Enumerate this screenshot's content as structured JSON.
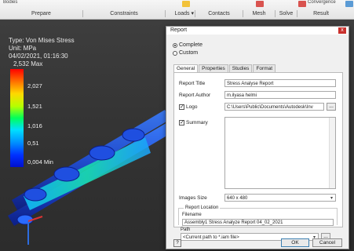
{
  "ribbon": {
    "top_left": "Bodies",
    "top_right": "Convergence",
    "groups": [
      "Prepare",
      "Constraints",
      "Loads",
      "Contacts",
      "Mesh",
      "Solve",
      "Result"
    ],
    "loads_arrow": "▾"
  },
  "legend": {
    "type_label": "Type: Von Mises Stress",
    "unit_label": "Unit: MPa",
    "timestamp": "04/02/2021, 01:16:30",
    "max_label": "2,532 Max",
    "ticks": [
      "2,027",
      "1,521",
      "1,016",
      "0,51",
      "0,004 Min"
    ]
  },
  "dialog": {
    "title": "Report",
    "close": "x",
    "radio_complete": "Complete",
    "radio_custom": "Custom",
    "tabs": [
      "General",
      "Properties",
      "Studies",
      "Format"
    ],
    "report_title_label": "Report Title",
    "report_title_value": "Stress Analyse Report",
    "report_author_label": "Report Author",
    "report_author_value": "m.ilyasa helmi",
    "logo_label": "Logo",
    "logo_path": "C:\\Users\\Public\\Documents\\Autodesk\\Inv",
    "browse": "...",
    "summary_label": "Summary",
    "images_size_label": "Images Size",
    "images_size_value": "640 x 480",
    "report_location_label": "Report Location",
    "filename_label": "Filename",
    "filename_value": "Assembly1 Stress Analyze Report 04_02_2021",
    "path_label": "Path",
    "path_value": "<Current path to *.iam file>",
    "ok": "OK",
    "cancel": "Cancel",
    "help": "?"
  }
}
